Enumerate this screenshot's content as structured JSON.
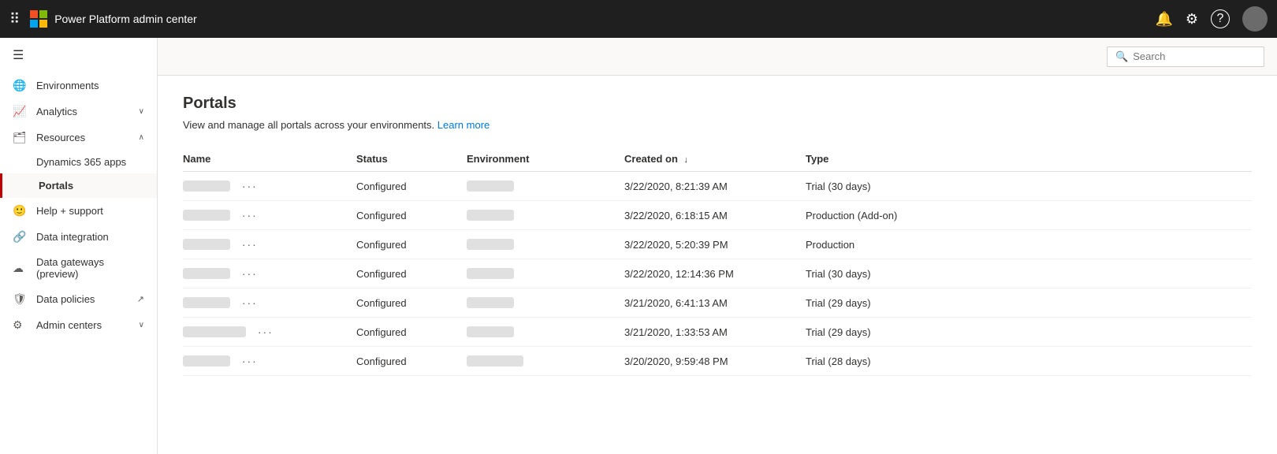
{
  "topbar": {
    "app_title": "Power Platform admin center",
    "search_placeholder": "Search"
  },
  "sidebar": {
    "hamburger_label": "≡",
    "items": [
      {
        "id": "environments",
        "label": "Environments",
        "icon": "🌐",
        "has_chevron": false,
        "active": false
      },
      {
        "id": "analytics",
        "label": "Analytics",
        "icon": "📈",
        "has_chevron": true,
        "active": false,
        "chevron": "∨"
      },
      {
        "id": "resources",
        "label": "Resources",
        "icon": "🗂",
        "has_chevron": true,
        "active": false,
        "chevron": "∧"
      },
      {
        "id": "dynamics365",
        "label": "Dynamics 365 apps",
        "icon": "",
        "is_subitem": true,
        "active": false
      },
      {
        "id": "portals",
        "label": "Portals",
        "icon": "",
        "is_subitem": true,
        "active": true
      },
      {
        "id": "help_support",
        "label": "Help + support",
        "icon": "🙂",
        "has_chevron": false,
        "active": false
      },
      {
        "id": "data_integration",
        "label": "Data integration",
        "icon": "🔗",
        "has_chevron": false,
        "active": false
      },
      {
        "id": "data_gateways",
        "label": "Data gateways (preview)",
        "icon": "☁",
        "has_chevron": false,
        "active": false
      },
      {
        "id": "data_policies",
        "label": "Data policies",
        "icon": "🛡",
        "has_chevron": false,
        "active": false,
        "external_icon": "↗"
      },
      {
        "id": "admin_centers",
        "label": "Admin centers",
        "icon": "⚙",
        "has_chevron": true,
        "active": false,
        "chevron": "∨"
      }
    ]
  },
  "content": {
    "page_title": "Portals",
    "description": "View and manage all portals across your environments.",
    "learn_more": "Learn more",
    "table": {
      "columns": [
        {
          "id": "name",
          "label": "Name"
        },
        {
          "id": "status",
          "label": "Status"
        },
        {
          "id": "environment",
          "label": "Environment"
        },
        {
          "id": "created_on",
          "label": "Created on",
          "sortable": true,
          "sort_dir": "↓"
        },
        {
          "id": "type",
          "label": "Type"
        }
      ],
      "rows": [
        {
          "name_blur": "██████████",
          "status": "Configured",
          "env_blur": "████████████",
          "created_on": "3/22/2020, 8:21:39 AM",
          "type": "Trial (30 days)"
        },
        {
          "name_blur": "████████",
          "status": "Configured",
          "env_blur": "██████████",
          "created_on": "3/22/2020, 6:18:15 AM",
          "type": "Production (Add-on)"
        },
        {
          "name_blur": "████████████",
          "status": "Configured",
          "env_blur": "██████",
          "created_on": "3/22/2020, 5:20:39 PM",
          "type": "Production"
        },
        {
          "name_blur": "██████████",
          "status": "Configured",
          "env_blur": "███████████",
          "created_on": "3/22/2020, 12:14:36 PM",
          "type": "Trial (30 days)"
        },
        {
          "name_blur": "███████████",
          "status": "Configured",
          "env_blur": "████████████",
          "created_on": "3/21/2020, 6:41:13 AM",
          "type": "Trial (29 days)"
        },
        {
          "name_blur": "████████████████",
          "status": "Configured",
          "env_blur": "█████████████",
          "created_on": "3/21/2020, 1:33:53 AM",
          "type": "Trial (29 days)"
        },
        {
          "name_blur": "██████",
          "status": "Configured",
          "env_blur": "████████████████",
          "created_on": "3/20/2020, 9:59:48 PM",
          "type": "Trial (28 days)"
        }
      ]
    }
  }
}
